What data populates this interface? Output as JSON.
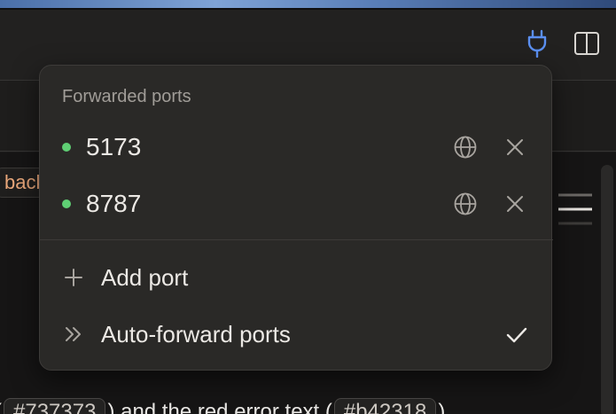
{
  "popup": {
    "title": "Forwarded ports",
    "ports": [
      {
        "label": "5173",
        "status_color": "#5fcf74",
        "icons": [
          "globe-icon",
          "close-icon"
        ]
      },
      {
        "label": "8787",
        "status_color": "#5fcf74",
        "icons": [
          "globe-icon",
          "close-icon"
        ]
      }
    ],
    "add_port_label": "Add port",
    "auto_forward_label": "Auto-forward ports",
    "auto_forward_checked": true
  },
  "toolbar": {
    "icons": [
      "plug-icon",
      "panel-layout-icon"
    ],
    "accent": "#5b8ff0"
  },
  "editor": {
    "code_chip": "back",
    "bottom_text_before": "(",
    "chip_1": "#737373",
    "bottom_text_middle": ") and the red error text (",
    "chip_2": "#b42318",
    "bottom_text_after": ")"
  }
}
